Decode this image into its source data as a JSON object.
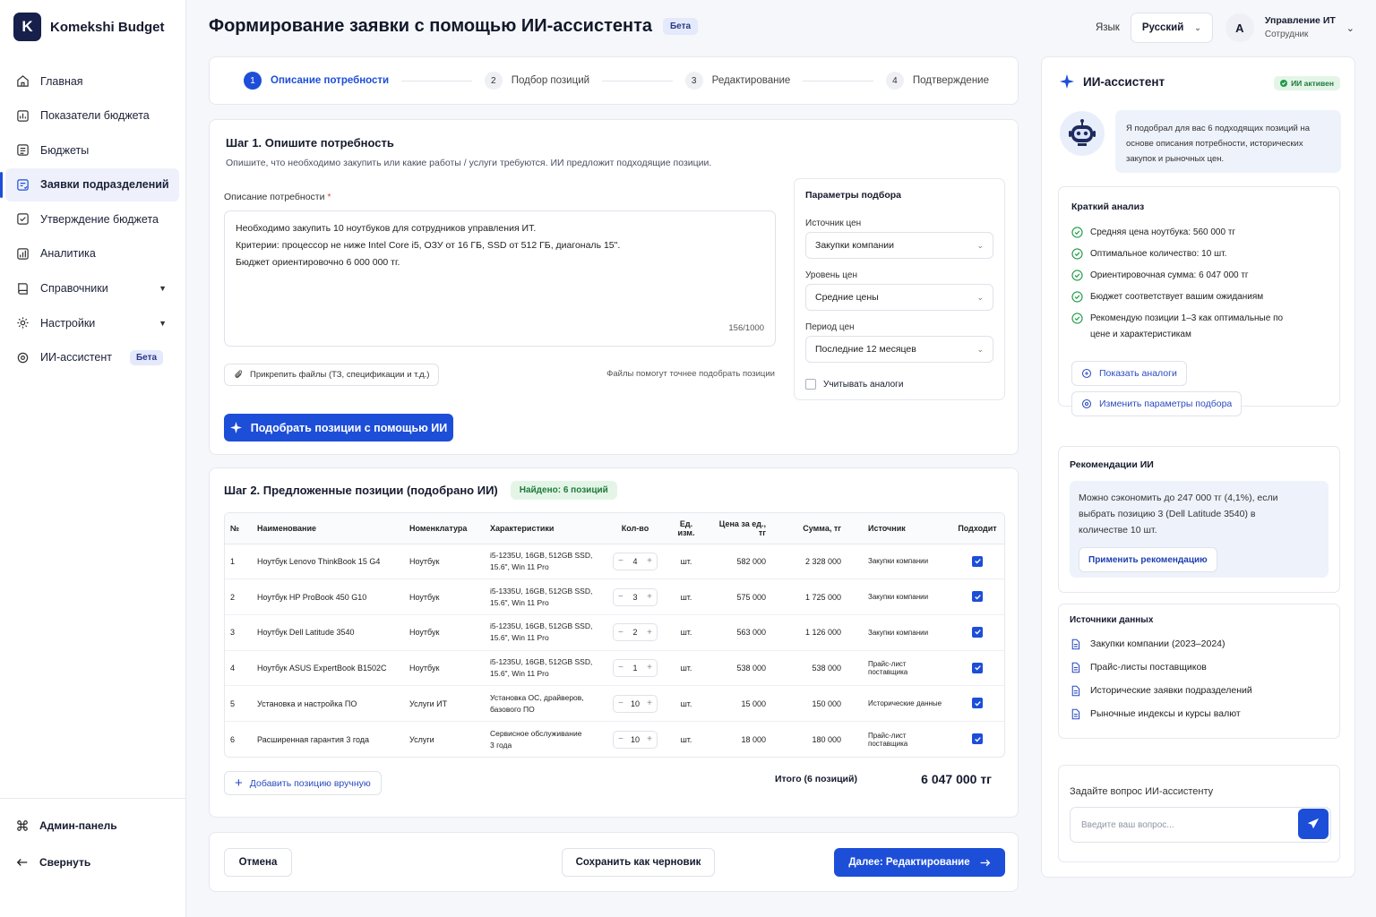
{
  "app": {
    "name": "Komekshi Budget",
    "logo_letter": "K"
  },
  "sidebar": {
    "items": [
      {
        "label": "Главная"
      },
      {
        "label": "Показатели бюджета"
      },
      {
        "label": "Бюджеты"
      },
      {
        "label": "Заявки подразделений"
      },
      {
        "label": "Утверждение бюджета"
      },
      {
        "label": "Аналитика"
      },
      {
        "label": "Справочники"
      },
      {
        "label": "Настройки"
      },
      {
        "label": "ИИ-ассистент",
        "badge": "Бета"
      }
    ],
    "bottom": {
      "admin": "Админ-панель",
      "collapse": "Свернуть"
    }
  },
  "header": {
    "title": "Формирование заявки с помощью ИИ-ассистента",
    "badge": "Бета",
    "lang_label": "Язык",
    "lang_value": "Русский",
    "avatar_letter": "А",
    "user_name": "Управление ИТ",
    "user_role": "Сотрудник"
  },
  "stepper": [
    {
      "num": "1",
      "label": "Описание потребности"
    },
    {
      "num": "2",
      "label": "Подбор позиций"
    },
    {
      "num": "3",
      "label": "Редактирование"
    },
    {
      "num": "4",
      "label": "Подтверждение"
    }
  ],
  "step1": {
    "title": "Шаг 1. Опишите потребность",
    "subtitle": "Опишите, что необходимо закупить или какие работы / услуги требуются. ИИ предложит подходящие позиции.",
    "field_label": "Описание потребности",
    "required_mark": "*",
    "lines": [
      "Необходимо закупить 10 ноутбуков для сотрудников управления ИТ.",
      "Критерии: процессор не ниже Intel Core i5, ОЗУ от 16 ГБ, SSD от 512 ГБ, диагональ 15\".",
      "Бюджет ориентировочно 6 000 000 тг."
    ],
    "counter": "156/1000",
    "attach_label": "Прикрепить файлы (ТЗ, спецификации и т.д.)",
    "attach_hint": "Файлы помогут точнее подобрать позиции",
    "submit_label": "Подобрать позиции с помощью ИИ",
    "params": {
      "title": "Параметры подбора",
      "price_source_label": "Источник цен",
      "price_source_value": "Закупки компании",
      "price_level_label": "Уровень цен",
      "price_level_value": "Средние цены",
      "price_period_label": "Период цен",
      "price_period_value": "Последние 12 месяцев",
      "analogs_label": "Учитывать аналоги"
    }
  },
  "step2": {
    "title": "Шаг 2. Предложенные позиции (подобрано ИИ)",
    "found_badge": "Найдено: 6 позиций",
    "columns": [
      "№",
      "Наименование",
      "Номенклатура",
      "Характеристики",
      "Кол-во",
      "Ед. изм.",
      "Цена за ед., тг",
      "Сумма, тг",
      "Источник",
      "Подходит"
    ],
    "rows": [
      {
        "n": "1",
        "name": "Ноутбук Lenovo ThinkBook 15 G4",
        "nom": "Ноутбук",
        "spec1": "i5-1235U, 16GB, 512GB SSD,",
        "spec2": "15.6\", Win 11 Pro",
        "qty": "4",
        "unit": "шт.",
        "price": "582 000",
        "sum": "2 328 000",
        "source": "Закупки компании"
      },
      {
        "n": "2",
        "name": "Ноутбук HP ProBook 450 G10",
        "nom": "Ноутбук",
        "spec1": "i5-1335U, 16GB, 512GB SSD,",
        "spec2": "15.6\", Win 11 Pro",
        "qty": "3",
        "unit": "шт.",
        "price": "575 000",
        "sum": "1 725 000",
        "source": "Закупки компании"
      },
      {
        "n": "3",
        "name": "Ноутбук Dell Latitude 3540",
        "nom": "Ноутбук",
        "spec1": "i5-1235U, 16GB, 512GB SSD,",
        "spec2": "15.6\", Win 11 Pro",
        "qty": "2",
        "unit": "шт.",
        "price": "563 000",
        "sum": "1 126 000",
        "source": "Закупки компании"
      },
      {
        "n": "4",
        "name": "Ноутбук ASUS ExpertBook B1502C",
        "nom": "Ноутбук",
        "spec1": "i5-1235U, 16GB, 512GB SSD,",
        "spec2": "15.6\", Win 11 Pro",
        "qty": "1",
        "unit": "шт.",
        "price": "538 000",
        "sum": "538 000",
        "source": "Прайс-лист поставщика"
      },
      {
        "n": "5",
        "name": "Установка и настройка ПО",
        "nom": "Услуги ИТ",
        "spec1": "Установка ОС, драйверов,",
        "spec2": "базового ПО",
        "qty": "10",
        "unit": "шт.",
        "price": "15 000",
        "sum": "150 000",
        "source": "Исторические данные"
      },
      {
        "n": "6",
        "name": "Расширенная гарантия 3 года",
        "nom": "Услуги",
        "spec1": "Сервисное обслуживание",
        "spec2": "3 года",
        "qty": "10",
        "unit": "шт.",
        "price": "18 000",
        "sum": "180 000",
        "source": "Прайс-лист поставщика"
      }
    ],
    "add_label": "Добавить позицию вручную",
    "total_label": "Итого (6 позиций)",
    "total_value": "6 047 000 тг"
  },
  "footer": {
    "cancel": "Отмена",
    "draft": "Сохранить как черновик",
    "next": "Далее: Редактирование"
  },
  "assistant": {
    "title": "ИИ-ассистент",
    "status": "ИИ активен",
    "message": "Я подобрал для вас 6 подходящих позиций на основе описания потребности, исторических закупок и рыночных цен.",
    "analysis_title": "Краткий анализ",
    "analysis": [
      "Средняя цена ноутбука: 560 000 тг",
      "Оптимальное количество:  10 шт.",
      "Ориентировочная сумма:  6 047 000 тг",
      "Бюджет соответствует вашим ожиданиям",
      "Рекомендую позиции 1–3 как оптимальные по цене и характеристикам"
    ],
    "show_analogs": "Показать аналоги",
    "change_params": "Изменить параметры подбора",
    "reco_title": "Рекомендации ИИ",
    "reco_text": "Можно сэкономить до 247 000 тг (4,1%), если выбрать позицию 3 (Dell Latitude 3540) в количестве 10 шт.",
    "apply_reco": "Применить рекомендацию",
    "sources_title": "Источники данных",
    "sources": [
      "Закупки компании (2023–2024)",
      "Прайс-листы поставщиков",
      "Исторические заявки подразделений",
      "Рыночные индексы и курсы валют"
    ],
    "ask_label": "Задайте вопрос ИИ-ассистенту",
    "ask_placeholder": "Введите ваш вопрос..."
  }
}
